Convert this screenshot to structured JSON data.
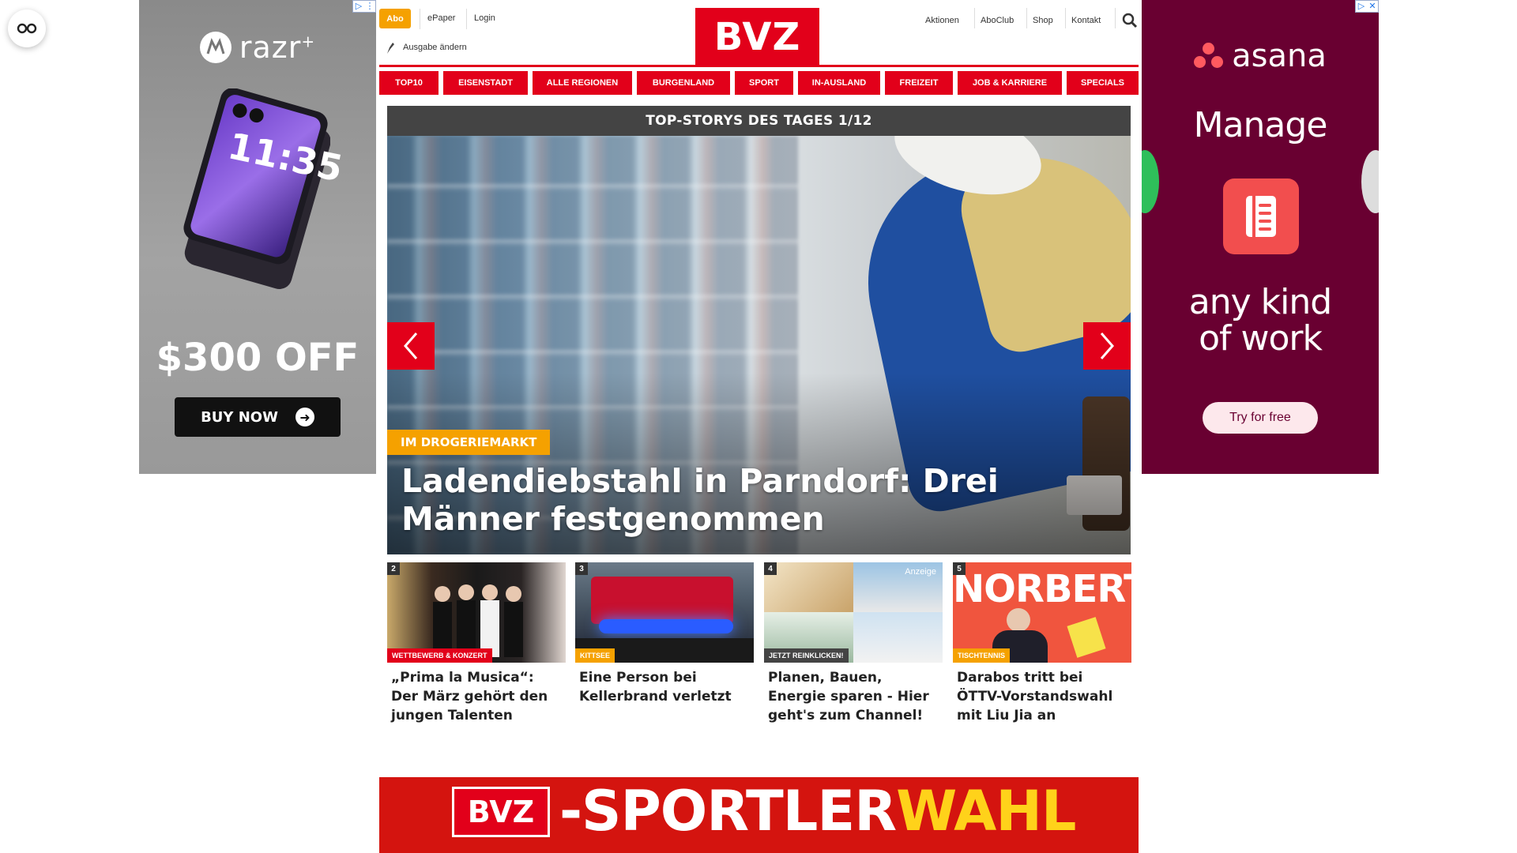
{
  "reader_button": {
    "icon": "glasses-icon"
  },
  "ad_left": {
    "brand": "razr",
    "brand_plus": "+",
    "phone_time": "11:35",
    "offer": "$300 OFF",
    "cta": "BUY NOW"
  },
  "ad_right": {
    "brand": "asana",
    "headline": "Manage",
    "tagline_1": "any kind",
    "tagline_2": "of work",
    "cta": "Try for free"
  },
  "header": {
    "abo": "Abo",
    "epaper": "ePaper",
    "login": "Login",
    "edition": "Ausgabe ändern",
    "logo": "BVZ",
    "links": [
      "Aktionen",
      "AboClub",
      "Shop",
      "Kontakt"
    ]
  },
  "nav": [
    "TOP10",
    "EISENSTADT",
    "ALLE REGIONEN",
    "BURGENLAND",
    "SPORT",
    "IN-AUSLAND",
    "FREIZEIT",
    "JOB & KARRIERE",
    "SPECIALS"
  ],
  "top_stories": {
    "bar_title": "TOP-STORYS DES TAGES 1/12",
    "hero_kicker": "IM DROGERIEMARKT",
    "hero_title": "Ladendiebstahl in Parndorf: Drei Männer festgenommen"
  },
  "cards": [
    {
      "num": "2",
      "kicker": "WETTBEWERB & KONZERT",
      "kicker_color": "#e2001a",
      "title": "„Prima la Musica“: Der März gehört den jungen Talenten"
    },
    {
      "num": "3",
      "kicker": "KITTSEE",
      "kicker_color": "#f5a100",
      "title": "Eine Person bei Kellerbrand verletzt"
    },
    {
      "num": "4",
      "kicker": "JETZT REINKLICKEN!",
      "kicker_color": "#444444",
      "badge": "Anzeige",
      "title": "Planen, Bauen, Energie sparen - Hier geht's zum Channel!"
    },
    {
      "num": "5",
      "kicker": "TISCHTENNIS",
      "kicker_color": "#f5a100",
      "image_text": "NORBERT",
      "title": "Darabos tritt bei ÖTTV-Vorstandswahl mit Liu Jia an"
    }
  ],
  "banner": {
    "logo": "BVZ",
    "text_white": "-SPORTLER",
    "text_yellow": "WAHL"
  },
  "colors": {
    "brand_red": "#e2001a",
    "accent_orange": "#f5a100",
    "asana_bg": "#690031"
  }
}
